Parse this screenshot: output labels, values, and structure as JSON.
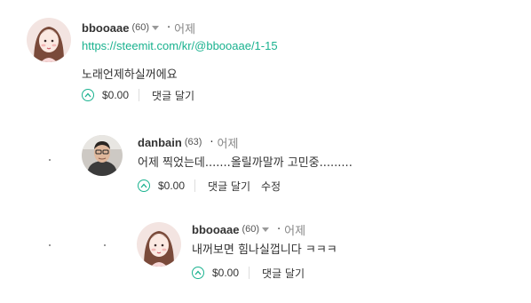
{
  "comments": [
    {
      "author": "bbooaae",
      "reputation": "(60)",
      "separator": "·",
      "time": "어제",
      "link": "https://steemit.com/kr/@bbooaae/1-15",
      "text": "노래언제하실꺼에요",
      "payout": "$0.00",
      "actions": [
        "댓글 달기"
      ]
    },
    {
      "author": "danbain",
      "reputation": "(63)",
      "separator": "·",
      "time": "어제",
      "text": "어제 찍었는데.......올릴까말까 고민중.........",
      "payout": "$0.00",
      "actions": [
        "댓글 달기",
        "수정"
      ]
    },
    {
      "author": "bbooaae",
      "reputation": "(60)",
      "separator": "·",
      "time": "어제",
      "text": "내꺼보면 힘나실껍니다 ㅋㅋㅋ",
      "payout": "$0.00",
      "actions": [
        "댓글 달기"
      ]
    }
  ],
  "icons": {
    "dropdown": "chevron-down-icon",
    "upvote": "upvote-chevron-icon"
  },
  "colors": {
    "accent": "#1ab28f",
    "text": "#333333",
    "muted": "#888888"
  }
}
